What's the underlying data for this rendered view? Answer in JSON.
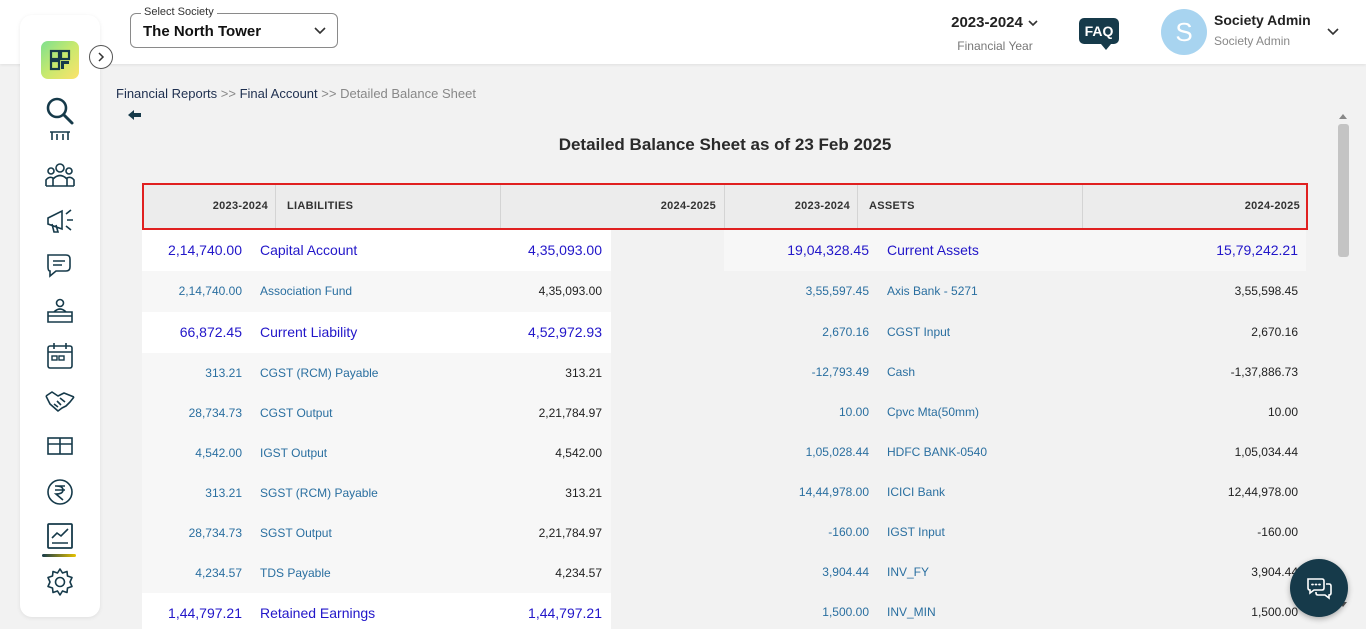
{
  "header": {
    "society_label": "Select Society",
    "society_value": "The North Tower",
    "financial_year": "2023-2024",
    "financial_year_caption": "Financial Year",
    "faq_label": "FAQ",
    "avatar_initial": "S",
    "user_name": "Society Admin",
    "user_role": "Society Admin"
  },
  "sidebar": {
    "items": [
      {
        "icon": "search-icon"
      },
      {
        "icon": "building-icon"
      },
      {
        "icon": "members-icon"
      },
      {
        "icon": "megaphone-icon"
      },
      {
        "icon": "chat-bubbles-icon"
      },
      {
        "icon": "helpdesk-icon"
      },
      {
        "icon": "calendar-icon"
      },
      {
        "icon": "handshake-icon"
      },
      {
        "icon": "parcel-icon"
      },
      {
        "icon": "rupee-icon"
      },
      {
        "icon": "reports-icon",
        "active": true
      },
      {
        "icon": "settings-icon"
      }
    ],
    "accent": "#163a4a"
  },
  "breadcrumb": {
    "items": [
      "Financial Reports",
      "Final Account",
      "Detailed Balance Sheet"
    ],
    "separator": ">>"
  },
  "report": {
    "title": "Detailed Balance Sheet as of 23 Feb 2025",
    "headers": {
      "left_prev": "2023-2024",
      "left_name": "LIABILITIES",
      "left_curr": "2024-2025",
      "right_prev": "2023-2024",
      "right_name": "ASSETS",
      "right_curr": "2024-2025"
    },
    "liabilities": [
      {
        "type": "group",
        "prev": "2,14,740.00",
        "name": "Capital Account",
        "curr": "4,35,093.00"
      },
      {
        "type": "item",
        "prev": "2,14,740.00",
        "name": "Association Fund",
        "curr": "4,35,093.00"
      },
      {
        "type": "group",
        "prev": "66,872.45",
        "name": "Current Liability",
        "curr": "4,52,972.93"
      },
      {
        "type": "item",
        "prev": "313.21",
        "name": "CGST (RCM) Payable",
        "curr": "313.21"
      },
      {
        "type": "item",
        "prev": "28,734.73",
        "name": "CGST Output",
        "curr": "2,21,784.97"
      },
      {
        "type": "item",
        "prev": "4,542.00",
        "name": "IGST Output",
        "curr": "4,542.00"
      },
      {
        "type": "item",
        "prev": "313.21",
        "name": "SGST (RCM) Payable",
        "curr": "313.21"
      },
      {
        "type": "item",
        "prev": "28,734.73",
        "name": "SGST Output",
        "curr": "2,21,784.97"
      },
      {
        "type": "item",
        "prev": "4,234.57",
        "name": "TDS Payable",
        "curr": "4,234.57"
      },
      {
        "type": "group",
        "prev": "1,44,797.21",
        "name": "Retained Earnings",
        "curr": "1,44,797.21"
      }
    ],
    "assets": [
      {
        "type": "group",
        "prev": "19,04,328.45",
        "name": "Current Assets",
        "curr": "15,79,242.21"
      },
      {
        "type": "item",
        "prev": "3,55,597.45",
        "name": "Axis Bank - 5271",
        "curr": "3,55,598.45"
      },
      {
        "type": "item",
        "prev": "2,670.16",
        "name": "CGST Input",
        "curr": "2,670.16"
      },
      {
        "type": "item",
        "prev": "-12,793.49",
        "name": "Cash",
        "curr": "-1,37,886.73"
      },
      {
        "type": "item",
        "prev": "10.00",
        "name": "Cpvc Mta(50mm)",
        "curr": "10.00"
      },
      {
        "type": "item",
        "prev": "1,05,028.44",
        "name": "HDFC BANK-0540",
        "curr": "1,05,034.44"
      },
      {
        "type": "item",
        "prev": "14,44,978.00",
        "name": "ICICI Bank",
        "curr": "12,44,978.00"
      },
      {
        "type": "item",
        "prev": "-160.00",
        "name": "IGST Input",
        "curr": "-160.00"
      },
      {
        "type": "item",
        "prev": "3,904.44",
        "name": "INV_FY",
        "curr": "3,904.44"
      },
      {
        "type": "item",
        "prev": "1,500.00",
        "name": "INV_MIN",
        "curr": "1,500.00"
      }
    ]
  },
  "colors": {
    "group_text": "#2216c9",
    "item_text": "#2a6fa0",
    "header_highlight": "#e02020",
    "brand_dark": "#163a4a"
  },
  "chat": {
    "icon": "chat-support-icon"
  }
}
